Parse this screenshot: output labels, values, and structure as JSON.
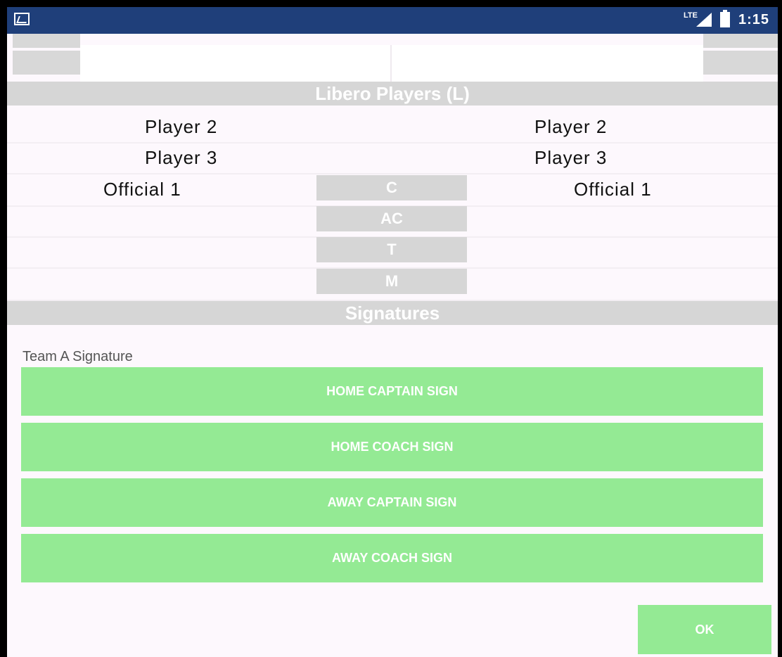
{
  "status_bar": {
    "network": "LTE",
    "time": "1:15"
  },
  "libero_section": {
    "header": "Libero Players (L)",
    "rows": [
      {
        "left": "Player  2",
        "right": "Player  2"
      },
      {
        "left": "Player  3",
        "right": "Player  3"
      }
    ]
  },
  "officials": {
    "left": "Official 1",
    "right": "Official 1",
    "roles": [
      "C",
      "AC",
      "T",
      "M"
    ]
  },
  "signatures": {
    "header": "Signatures",
    "label": "Team A Signature",
    "buttons": [
      "HOME CAPTAIN SIGN",
      "HOME COACH SIGN",
      "AWAY CAPTAIN SIGN",
      "AWAY COACH SIGN"
    ]
  },
  "ok_label": "OK",
  "colors": {
    "status_bar": "#1f3f7a",
    "header_gray": "#d6d6d6",
    "button_green": "#94ea94"
  }
}
